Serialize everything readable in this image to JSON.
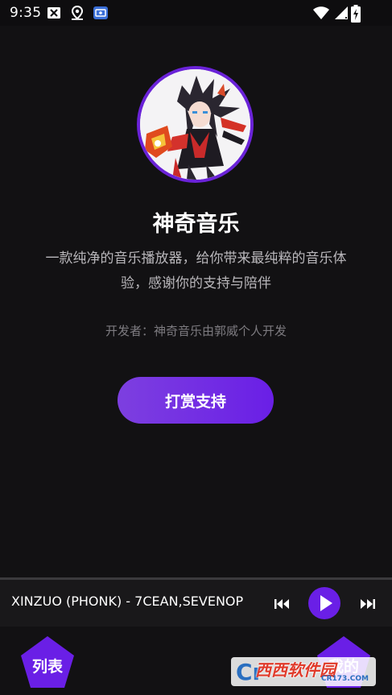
{
  "status_bar": {
    "time": "9:35",
    "icons": [
      "mail-x-icon",
      "location-icon",
      "app-badge-icon",
      "wifi-icon",
      "signal-icon",
      "battery-charging-icon"
    ]
  },
  "about": {
    "title": "神奇音乐",
    "description": "一款纯净的音乐播放器，给你带来最纯粹的音乐体验，感谢你的支持与陪伴",
    "developer": "开发者：神奇音乐由郭威个人开发",
    "donate_label": "打赏支持"
  },
  "player": {
    "track": "XINZUO (PHONK) - 7CEAN,SEVENOP",
    "controls": [
      "previous-icon",
      "play-icon",
      "next-icon"
    ]
  },
  "nav": {
    "list_label": "列表",
    "mine_label": "我的"
  },
  "colors": {
    "accent": "#6a1fe6",
    "background": "#121113",
    "player_bg": "#19181a"
  },
  "watermark": {
    "main": "西西软件园",
    "sub": "CR173.COM"
  }
}
